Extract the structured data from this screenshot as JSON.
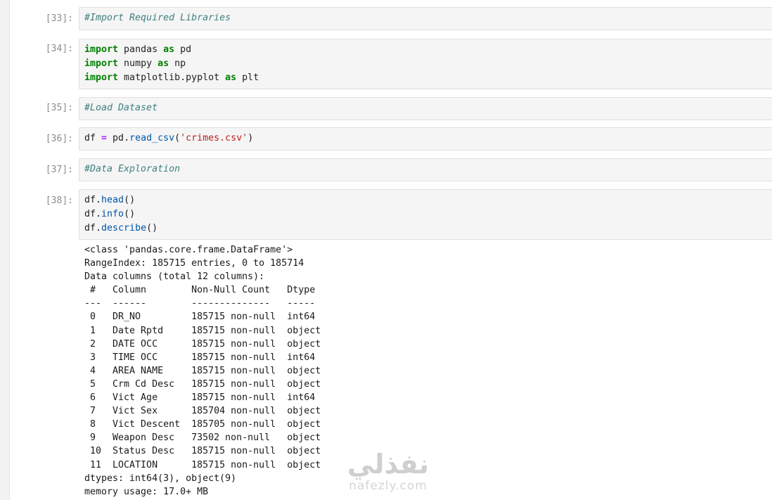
{
  "cells": [
    {
      "prompt": "[33]:",
      "lines": [
        "#Import Required Libraries"
      ]
    },
    {
      "prompt": "[34]:",
      "lines": [
        "import pandas as pd",
        "import numpy as np",
        "import matplotlib.pyplot as plt"
      ]
    },
    {
      "prompt": "[35]:",
      "lines": [
        "#Load Dataset"
      ]
    },
    {
      "prompt": "[36]:",
      "lines": [
        "df = pd.read_csv('crimes.csv')"
      ]
    },
    {
      "prompt": "[37]:",
      "lines": [
        "#Data Exploration"
      ]
    },
    {
      "prompt": "[38]:",
      "lines": [
        "df.head()",
        "df.info()",
        "df.describe()"
      ]
    }
  ],
  "output": {
    "lines": [
      "<class 'pandas.core.frame.DataFrame'>",
      "RangeIndex: 185715 entries, 0 to 185714",
      "Data columns (total 12 columns):",
      " #   Column        Non-Null Count   Dtype ",
      "---  ------        --------------   ----- ",
      " 0   DR_NO         185715 non-null  int64 ",
      " 1   Date Rptd     185715 non-null  object",
      " 2   DATE OCC      185715 non-null  object",
      " 3   TIME OCC      185715 non-null  int64 ",
      " 4   AREA NAME     185715 non-null  object",
      " 5   Crm Cd Desc   185715 non-null  object",
      " 6   Vict Age      185715 non-null  int64 ",
      " 7   Vict Sex      185704 non-null  object",
      " 8   Vict Descent  185705 non-null  object",
      " 9   Weapon Desc   73502 non-null   object",
      " 10  Status Desc   185715 non-null  object",
      " 11  LOCATION      185715 non-null  object",
      "dtypes: int64(3), object(9)",
      "memory usage: 17.0+ MB"
    ]
  },
  "watermark": {
    "arabic": "نفذلي",
    "latin": "nafezly.com"
  }
}
